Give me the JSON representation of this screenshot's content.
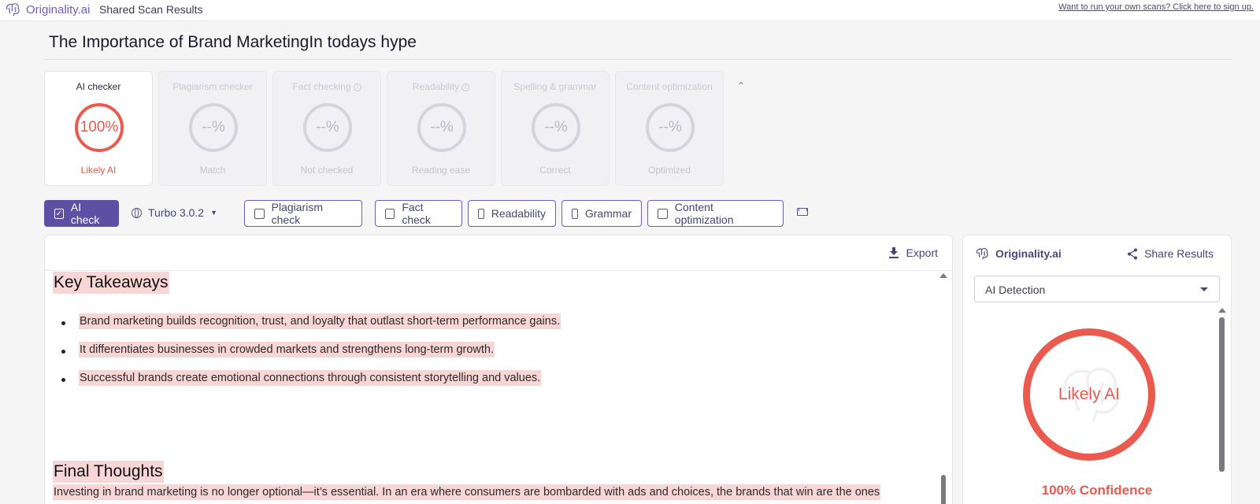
{
  "topbar": {
    "brand": "Originality.ai",
    "title": "Shared Scan Results",
    "signup_link": "Want to run your own scans? Click here to sign up."
  },
  "document": {
    "title": "The Importance of Brand MarketingIn todays hype"
  },
  "cards": [
    {
      "label": "AI checker",
      "value": "100%",
      "sub": "Likely AI",
      "active": true
    },
    {
      "label": "Plagiarism checker",
      "value": "--%",
      "sub": "Match"
    },
    {
      "label": "Fact checking",
      "value": "--%",
      "sub": "Not checked",
      "info": true
    },
    {
      "label": "Readability",
      "value": "--%",
      "sub": "Reading ease",
      "info": true
    },
    {
      "label": "Spelling & grammar",
      "value": "--%",
      "sub": "Correct"
    },
    {
      "label": "Content optimization",
      "value": "--%",
      "sub": "Optimized"
    }
  ],
  "toolbar": {
    "ai_check": "AI check",
    "model": "Turbo 3.0.2",
    "plagiarism": "Plagiarism check",
    "fact": "Fact check",
    "readability": "Readability",
    "grammar": "Grammar",
    "content_opt": "Content optimization"
  },
  "panel": {
    "export": "Export",
    "heading1": "Key Takeaways",
    "bullets": [
      "Brand marketing builds recognition, trust, and loyalty that outlast short-term performance gains.",
      "It differentiates businesses in crowded markets and strengthens long-term growth.",
      "Successful brands create emotional connections through consistent storytelling and values."
    ],
    "heading2": "Final Thoughts",
    "paragraph": "Investing in brand marketing is no longer optional—it’s essential. In an era where consumers are bombarded with ads and choices, the brands that win are the ones"
  },
  "side": {
    "brand": "Originality.ai",
    "share": "Share Results",
    "select_value": "AI Detection",
    "ring_text": "Likely AI",
    "confidence": "100% Confidence"
  },
  "colors": {
    "accent": "#5d4fa3",
    "ai_red": "#ea5a4e",
    "highlight": "#f9d6d6"
  }
}
